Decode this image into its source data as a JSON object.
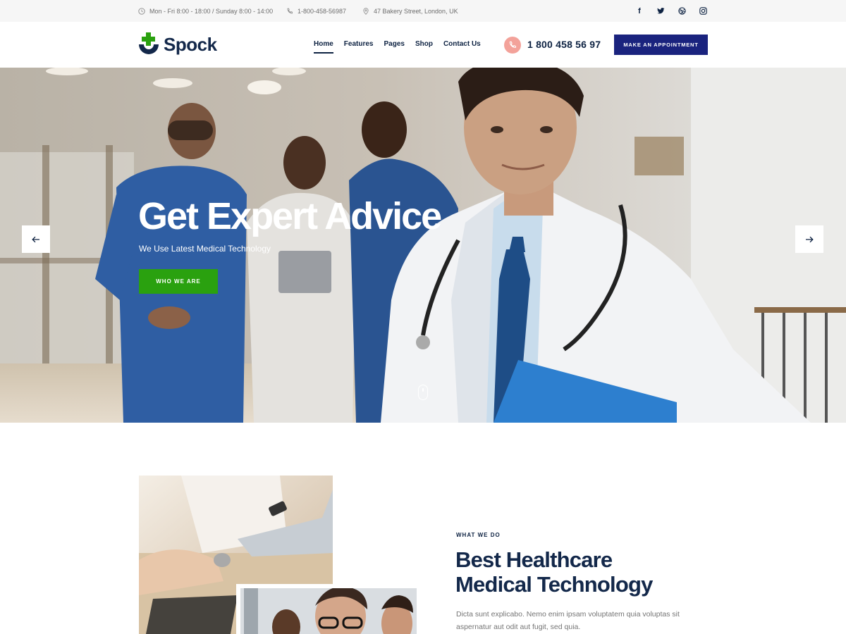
{
  "topbar": {
    "hours": "Mon - Fri 8:00 - 18:00  /  Sunday 8:00 - 14:00",
    "phone": "1-800-458-56987",
    "address": "47 Bakery Street, London, UK",
    "socials": [
      "facebook-icon",
      "twitter-icon",
      "dribbble-icon",
      "instagram-icon"
    ]
  },
  "header": {
    "logo_text": "Spock",
    "nav": [
      "Home",
      "Features",
      "Pages",
      "Shop",
      "Contact Us"
    ],
    "active_nav": "Home",
    "phone_number": "1 800 458 56 97",
    "appointment_label": "MAKE AN APPOINTMENT"
  },
  "hero": {
    "title": "Get Expert Advice",
    "subtitle": "We Use Latest Medical Technology",
    "button_label": "WHO WE ARE"
  },
  "about": {
    "eyebrow": "WHAT WE DO",
    "title_line1": "Best Healthcare",
    "title_line2": "Medical Technology",
    "text": "Dicta sunt explicabo. Nemo enim ipsam voluptatem quia voluptas sit aspernatur aut odit aut fugit, sed quia."
  },
  "colors": {
    "brand_navy": "#1a237e",
    "heading": "#13284a",
    "accent_green": "#2aa10f",
    "phone_pink": "#f3a29a",
    "topbar_bg": "#f6f6f6"
  }
}
